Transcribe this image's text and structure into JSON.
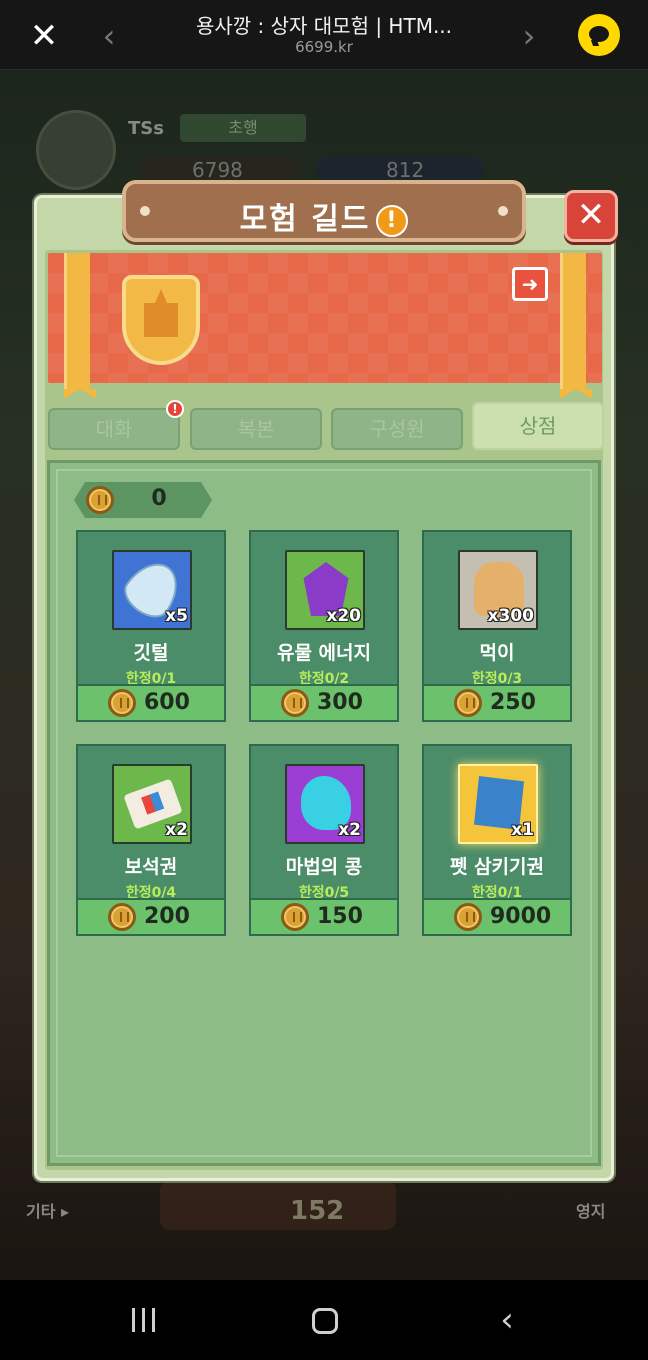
{
  "browser": {
    "title": "용사깡 : 상자 대모험 | HTM...",
    "url": "6699.kr",
    "close_glyph": "✕",
    "back_glyph": "‹",
    "forward_glyph": "›"
  },
  "background": {
    "player_name": "TSs",
    "rank_label": "초행",
    "gold": "6798",
    "gems": "812",
    "left_label": "기타 ▸",
    "right_label": "영지",
    "center_value": "152"
  },
  "modal": {
    "title": "모험 길드",
    "title_warning": "!",
    "close_glyph": "✕",
    "exit_glyph": "➜"
  },
  "tabs": [
    {
      "label": "대화",
      "badge": "!"
    },
    {
      "label": "복본"
    },
    {
      "label": "구성원"
    },
    {
      "label": "상점",
      "active": true
    }
  ],
  "shop": {
    "currency_value": "0",
    "items": [
      {
        "name": "깃털",
        "qty": "x5",
        "limit": "한정0/1",
        "price": "600",
        "icon": "feather-icon"
      },
      {
        "name": "유물 에너지",
        "qty": "x20",
        "limit": "한정0/2",
        "price": "300",
        "icon": "crystal-icon"
      },
      {
        "name": "먹이",
        "qty": "x300",
        "limit": "한정0/3",
        "price": "250",
        "icon": "food-icon"
      },
      {
        "name": "보석권",
        "qty": "x2",
        "limit": "한정0/4",
        "price": "200",
        "icon": "ticket-icon"
      },
      {
        "name": "마법의 콩",
        "qty": "x2",
        "limit": "한정0/5",
        "price": "150",
        "icon": "bean-icon"
      },
      {
        "name": "펫 삼키기권",
        "qty": "x1",
        "limit": "한정0/1",
        "price": "9000",
        "icon": "scroll-icon"
      }
    ]
  },
  "colors": {
    "panel": "#c3d7a9",
    "banner": "#e7694a",
    "card": "#4b8c69",
    "price_bar": "#6cc26c",
    "limit_text": "#b7ec5a"
  }
}
